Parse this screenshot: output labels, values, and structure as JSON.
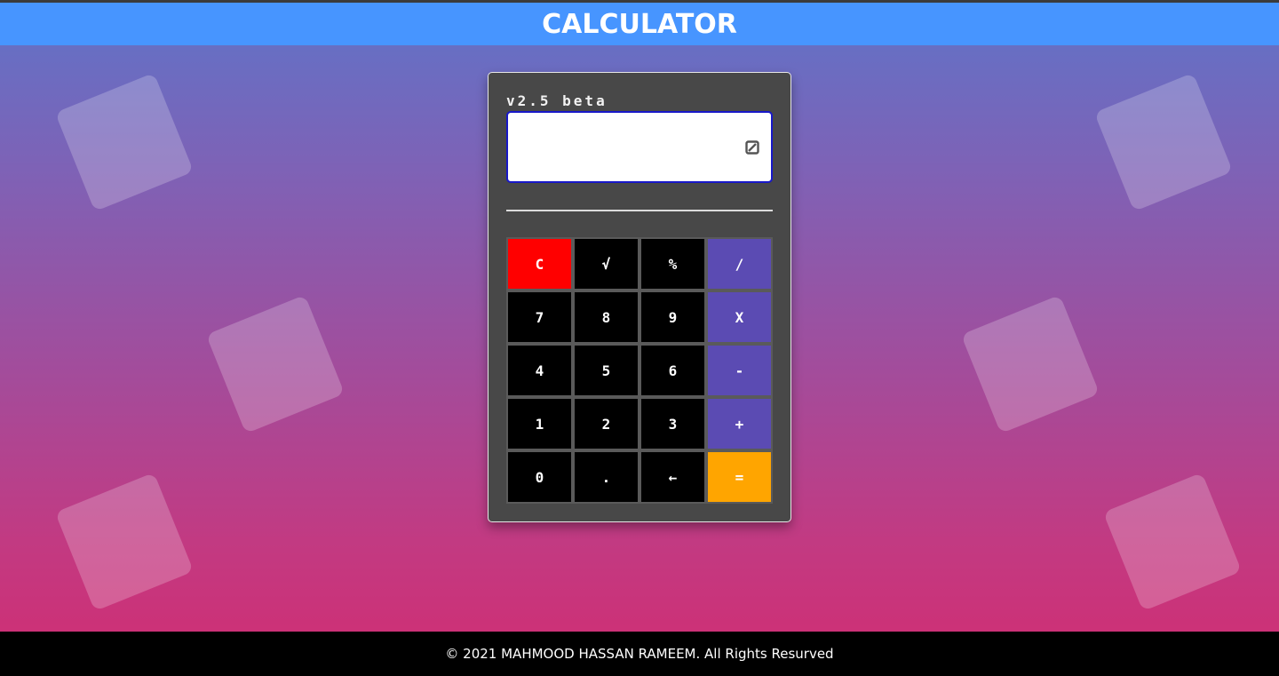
{
  "header": {
    "title": "CALCULATOR"
  },
  "calculator": {
    "version": "v2.5 beta",
    "display_value": "",
    "edit_icon": "edit-slash-icon",
    "keys": [
      {
        "label": "C",
        "name": "clear-button",
        "kind": "red"
      },
      {
        "label": "√",
        "name": "sqrt-button",
        "kind": "num"
      },
      {
        "label": "%",
        "name": "percent-button",
        "kind": "num"
      },
      {
        "label": "/",
        "name": "divide-button",
        "kind": "op"
      },
      {
        "label": "7",
        "name": "key-7-button",
        "kind": "num"
      },
      {
        "label": "8",
        "name": "key-8-button",
        "kind": "num"
      },
      {
        "label": "9",
        "name": "key-9-button",
        "kind": "num"
      },
      {
        "label": "X",
        "name": "multiply-button",
        "kind": "op"
      },
      {
        "label": "4",
        "name": "key-4-button",
        "kind": "num"
      },
      {
        "label": "5",
        "name": "key-5-button",
        "kind": "num"
      },
      {
        "label": "6",
        "name": "key-6-button",
        "kind": "num"
      },
      {
        "label": "-",
        "name": "subtract-button",
        "kind": "op"
      },
      {
        "label": "1",
        "name": "key-1-button",
        "kind": "num"
      },
      {
        "label": "2",
        "name": "key-2-button",
        "kind": "num"
      },
      {
        "label": "3",
        "name": "key-3-button",
        "kind": "num"
      },
      {
        "label": "+",
        "name": "add-button",
        "kind": "op"
      },
      {
        "label": "0",
        "name": "key-0-button",
        "kind": "num"
      },
      {
        "label": ".",
        "name": "decimal-button",
        "kind": "num"
      },
      {
        "label": "←",
        "name": "backspace-button",
        "kind": "num"
      },
      {
        "label": "=",
        "name": "equals-button",
        "kind": "eq"
      }
    ]
  },
  "footer": {
    "text": "© 2021 MAHMOOD HASSAN RAMEEM. All Rights Resurved"
  },
  "colors": {
    "header": "#4795ff",
    "clear": "#ff0000",
    "operator": "#5b4bb3",
    "equals": "#ffa500",
    "panel": "#484848"
  }
}
